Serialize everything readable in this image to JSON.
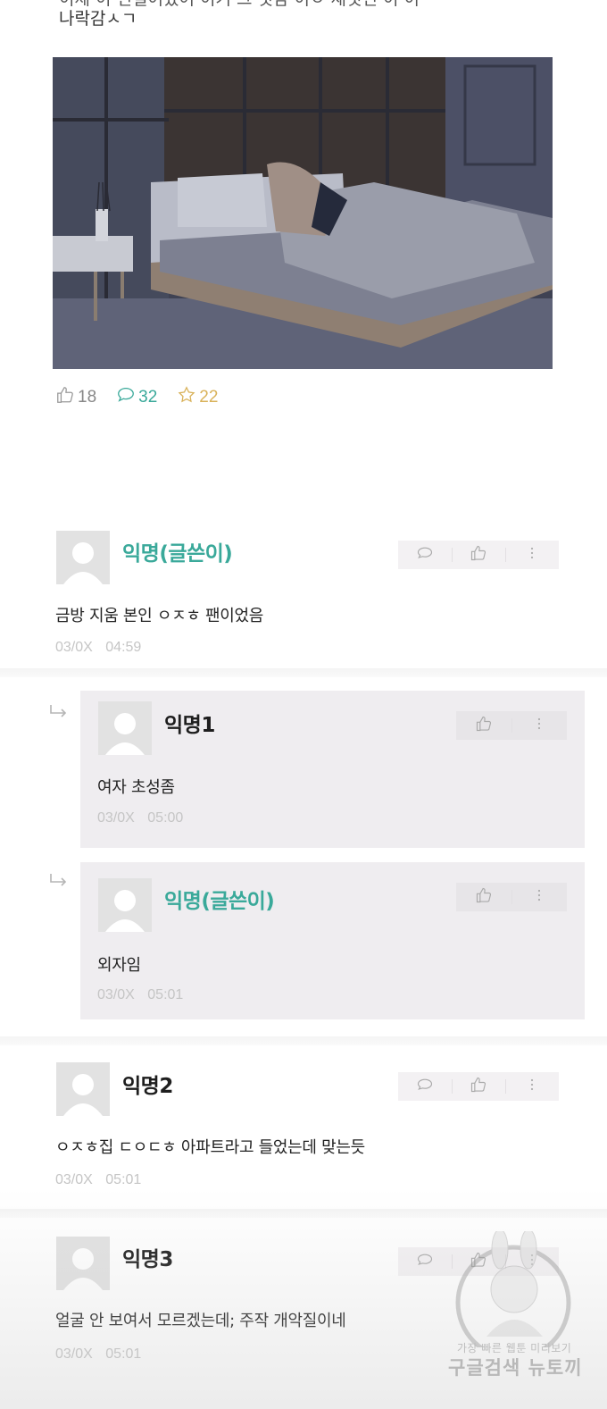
{
  "post": {
    "text_line1_partial": "이제 이 언걸어었어 이거 그 것감 이ㅇ 새것인 이 이",
    "text_line2": "나락감ㅅㄱ",
    "stats": {
      "likes": "18",
      "comments": "32",
      "favorites": "22"
    }
  },
  "comments": [
    {
      "name": "익명(글쓴이)",
      "text": "금방 지움 본인 ㅇㅈㅎ 팬이었음",
      "date": "03/0X",
      "time": "04:59",
      "is_author": true
    },
    {
      "name": "익명1",
      "text": "여자 초성좀",
      "date": "03/0X",
      "time": "05:00",
      "is_reply": true
    },
    {
      "name": "익명(글쓴이)",
      "text": "외자임",
      "date": "03/0X",
      "time": "05:01",
      "is_reply": true,
      "is_author": true
    },
    {
      "name": "익명2",
      "text": "ㅇㅈㅎ집 ㄷㅇㄷㅎ 아파트라고 들었는데 맞는듯",
      "date": "03/0X",
      "time": "05:01"
    },
    {
      "name": "익명3",
      "text": "얼굴 안 보여서 모르겠는데; 주작 개악질이네",
      "date": "03/0X",
      "time": "05:01"
    }
  ],
  "watermark": {
    "line1": "가장 빠른 웹툰 미리보기",
    "line2": "구글검색 뉴토끼"
  },
  "colors": {
    "author_name": "#3aa99a",
    "comment_icon": "#3aa99a",
    "star_icon": "#d9b25a",
    "meta": "#c5c5c5",
    "reply_bg": "#efedf0"
  },
  "icons": [
    "thumbs-up-icon",
    "speech-bubble-icon",
    "star-icon",
    "more-vertical-icon",
    "reply-arrow-icon",
    "avatar-icon"
  ]
}
